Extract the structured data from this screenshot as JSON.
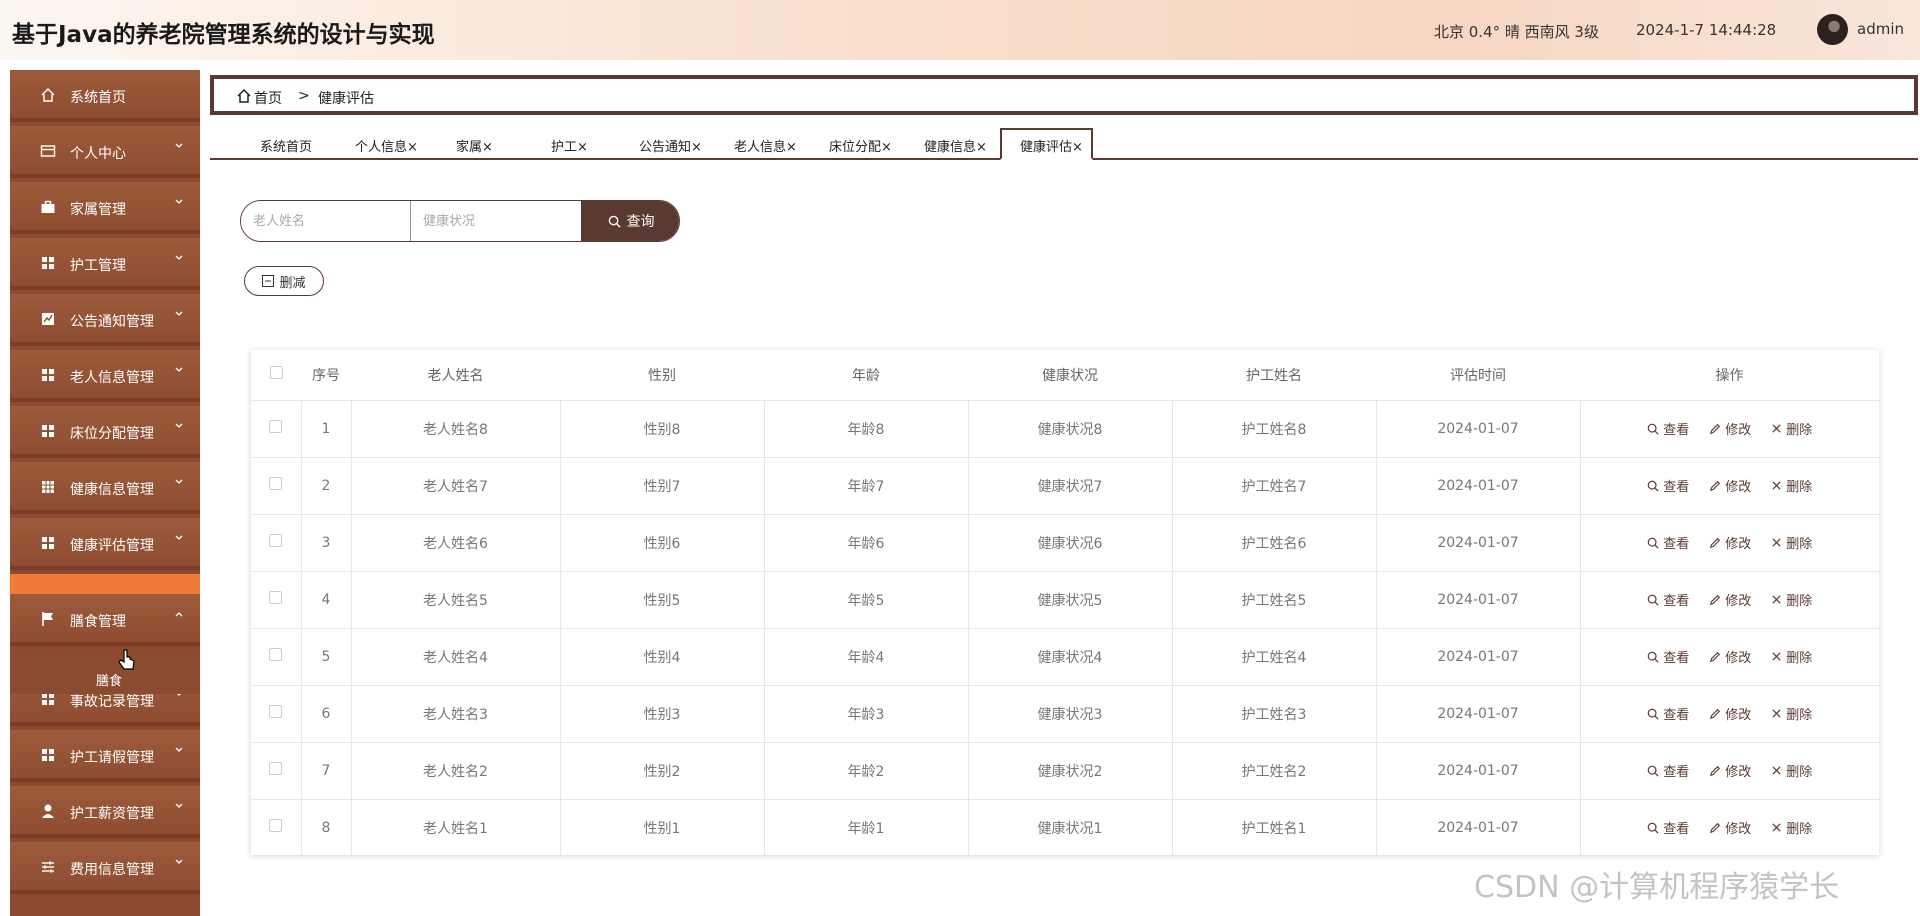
{
  "header": {
    "title": "基于Java的养老院管理系统的设计与实现",
    "weather": "北京 0.4° 晴 西南风 3级",
    "datetime": "2024-1-7 14:44:28",
    "username": "admin"
  },
  "sidebar": {
    "items": [
      {
        "label": "系统首页",
        "icon": "home-icon"
      },
      {
        "label": "个人中心",
        "icon": "id-card-icon"
      },
      {
        "label": "家属管理",
        "icon": "briefcase-icon"
      },
      {
        "label": "护工管理",
        "icon": "grid-icon"
      },
      {
        "label": "公告通知管理",
        "icon": "chart-icon"
      },
      {
        "label": "老人信息管理",
        "icon": "grid-icon"
      },
      {
        "label": "床位分配管理",
        "icon": "grid-icon"
      },
      {
        "label": "健康信息管理",
        "icon": "table-icon"
      },
      {
        "label": "健康评估管理",
        "icon": "grid-icon"
      },
      {
        "label": "膳食管理",
        "icon": "flag-icon"
      },
      {
        "label": "事故记录管理",
        "icon": "grid-icon"
      },
      {
        "label": "护工请假管理",
        "icon": "grid-icon"
      },
      {
        "label": "护工薪资管理",
        "icon": "user-icon"
      },
      {
        "label": "费用信息管理",
        "icon": "sliders-icon"
      }
    ],
    "sub_item": "膳食"
  },
  "breadcrumb": {
    "home": "首页",
    "separator": ">",
    "current": "健康评估"
  },
  "tabs": [
    "系统首页",
    "个人信息×",
    "家属×",
    "护工×",
    "公告通知×",
    "老人信息×",
    "床位分配×",
    "健康信息×",
    "健康评估×"
  ],
  "search": {
    "name_placeholder": "老人姓名",
    "status_placeholder": "健康状况",
    "button": "查询",
    "delete_button": "删减"
  },
  "table": {
    "headers": [
      "序号",
      "老人姓名",
      "性别",
      "年龄",
      "健康状况",
      "护工姓名",
      "评估时间",
      "操作"
    ],
    "rows": [
      {
        "no": "1",
        "name": "老人姓名8",
        "gender": "性别8",
        "age": "年龄8",
        "health": "健康状况8",
        "nurse": "护工姓名8",
        "date": "2024-01-07"
      },
      {
        "no": "2",
        "name": "老人姓名7",
        "gender": "性别7",
        "age": "年龄7",
        "health": "健康状况7",
        "nurse": "护工姓名7",
        "date": "2024-01-07"
      },
      {
        "no": "3",
        "name": "老人姓名6",
        "gender": "性别6",
        "age": "年龄6",
        "health": "健康状况6",
        "nurse": "护工姓名6",
        "date": "2024-01-07"
      },
      {
        "no": "4",
        "name": "老人姓名5",
        "gender": "性别5",
        "age": "年龄5",
        "health": "健康状况5",
        "nurse": "护工姓名5",
        "date": "2024-01-07"
      },
      {
        "no": "5",
        "name": "老人姓名4",
        "gender": "性别4",
        "age": "年龄4",
        "health": "健康状况4",
        "nurse": "护工姓名4",
        "date": "2024-01-07"
      },
      {
        "no": "6",
        "name": "老人姓名3",
        "gender": "性别3",
        "age": "年龄3",
        "health": "健康状况3",
        "nurse": "护工姓名3",
        "date": "2024-01-07"
      },
      {
        "no": "7",
        "name": "老人姓名2",
        "gender": "性别2",
        "age": "年龄2",
        "health": "健康状况2",
        "nurse": "护工姓名2",
        "date": "2024-01-07"
      },
      {
        "no": "8",
        "name": "老人姓名1",
        "gender": "性别1",
        "age": "年龄1",
        "health": "健康状况1",
        "nurse": "护工姓名1",
        "date": "2024-01-07"
      }
    ],
    "actions": {
      "view": "查看",
      "edit": "修改",
      "delete": "删除"
    }
  },
  "watermark": "CSDN @计算机程序猿学长",
  "colors": {
    "accent": "#5a3a30",
    "sidebar": "#8b4a30",
    "active": "#f07a3a"
  }
}
